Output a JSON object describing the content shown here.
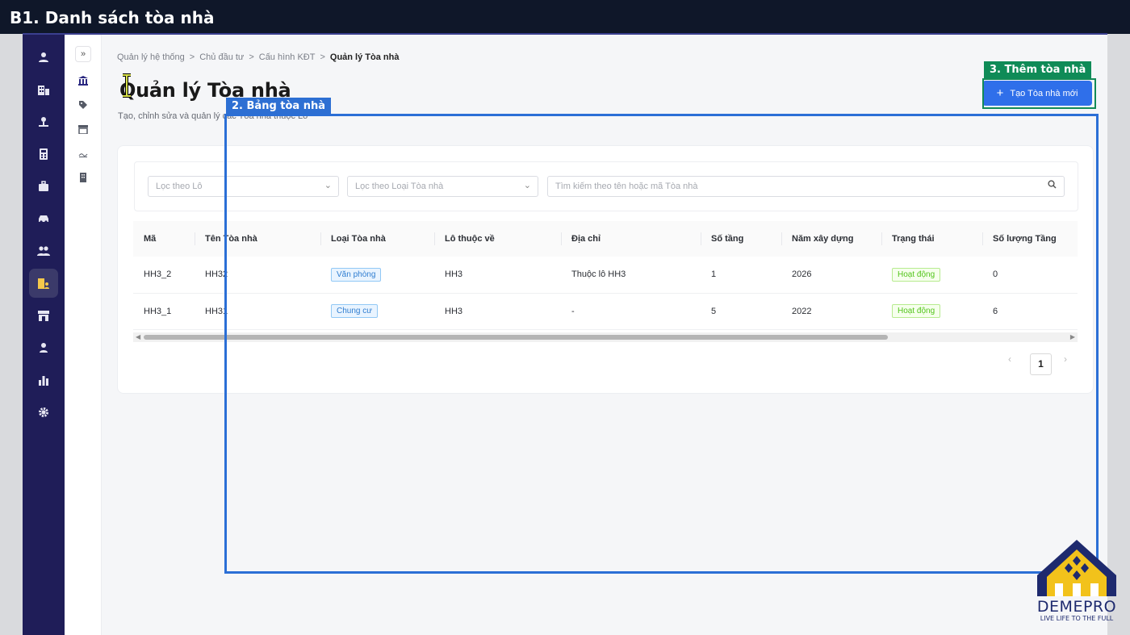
{
  "slide_title": "B1. Danh sách tòa nhà",
  "breadcrumb": [
    "Quản lý hệ thống",
    "Chủ đầu tư",
    "Cấu hình KĐT",
    "Quản lý Tòa nhà"
  ],
  "breadcrumb_sep": ">",
  "page": {
    "title": "Quản lý Tòa nhà",
    "subtitle": "Tạo, chỉnh sửa và quản lý các Tòa nhà thuộc Lô",
    "create_button": "Tạo Tòa nhà mới",
    "create_icon": "plus-icon"
  },
  "filters": {
    "lot_placeholder": "Lọc theo Lô",
    "type_placeholder": "Lọc theo Loại Tòa nhà",
    "search_placeholder": "Tìm kiếm theo tên hoặc mã Tòa nhà"
  },
  "table": {
    "columns": [
      "Mã",
      "Tên Tòa nhà",
      "Loại Tòa nhà",
      "Lô thuộc về",
      "Địa chỉ",
      "Số tầng",
      "Năm xây dựng",
      "Trạng thái",
      "Số lượng Tầng"
    ],
    "rows": [
      {
        "code": "HH3_2",
        "name": "HH32",
        "type": "Văn phòng",
        "lot": "HH3",
        "address": "Thuộc lô HH3",
        "floors": "1",
        "year": "2026",
        "status": "Hoạt động",
        "floor_count": "0"
      },
      {
        "code": "HH3_1",
        "name": "HH31",
        "type": "Chung cư",
        "lot": "HH3",
        "address": "-",
        "floors": "5",
        "year": "2022",
        "status": "Hoạt động",
        "floor_count": "6"
      }
    ]
  },
  "pagination": {
    "current": "1",
    "prev": "‹",
    "next": "›"
  },
  "overlays": {
    "table_label": "2. Bảng tòa nhà",
    "add_label": "3. Thêm tòa nhà"
  },
  "logo": {
    "brand": "DEMEPRO",
    "tagline": "LIVE LIFE TO THE FULL"
  },
  "sidebar_icons": [
    "user-icon",
    "buildings-icon",
    "tree-icon",
    "calculator-icon",
    "briefcase-icon",
    "car-icon",
    "users-icon",
    "building-user-icon",
    "store-icon",
    "person-icon",
    "chart-icon",
    "gear-icon"
  ],
  "colors": {
    "sidebar": "#1f1d58",
    "primary": "#2f6fea",
    "active_icon": "#f5c84b",
    "tag_green": "#52c41a",
    "tag_blue": "#2f7dd0"
  }
}
